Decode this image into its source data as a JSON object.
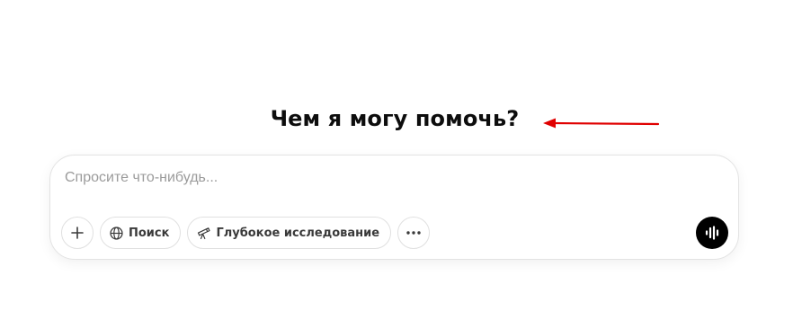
{
  "greeting": "Чем я могу помочь?",
  "composer": {
    "placeholder": "Спросите что-нибудь...",
    "value": ""
  },
  "toolbar": {
    "add_icon": "plus-icon",
    "search_label": "Поиск",
    "search_icon": "globe-icon",
    "deep_research_label": "Глубокое исследование",
    "deep_research_icon": "telescope-icon",
    "more_icon": "more-horizontal-icon",
    "voice_icon": "voice-waveform-icon"
  },
  "annotation": {
    "arrow_color": "#e00000"
  },
  "colors": {
    "voice_button_bg": "#000000",
    "placeholder": "#9b9b9b"
  }
}
